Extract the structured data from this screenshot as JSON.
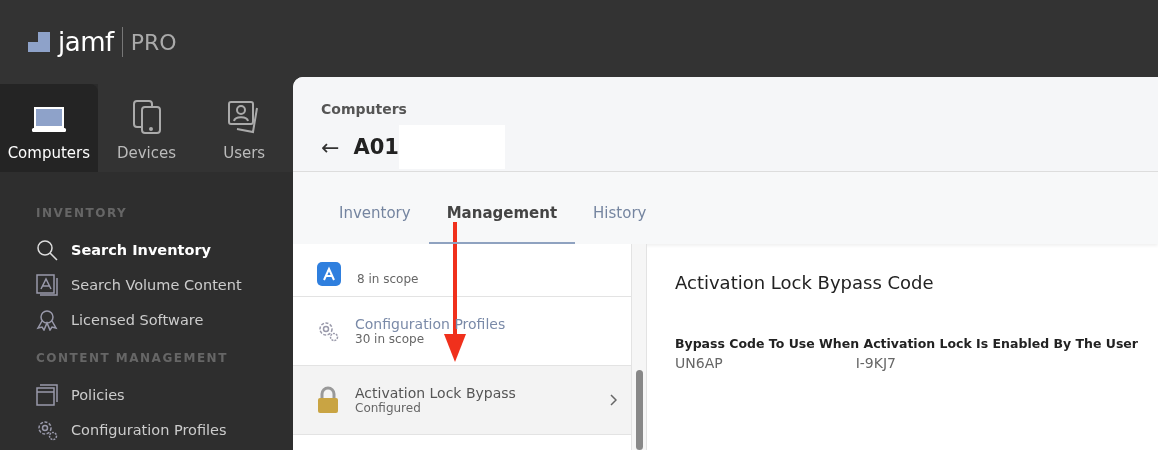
{
  "logo": {
    "brand": "jamf",
    "product": "PRO"
  },
  "nav_tabs": [
    {
      "label": "Computers",
      "kind": "laptop",
      "selected": true
    },
    {
      "label": "Devices",
      "kind": "phone",
      "selected": false
    },
    {
      "label": "Users",
      "kind": "user",
      "selected": false
    }
  ],
  "sidebar": {
    "sections": [
      {
        "heading": "INVENTORY",
        "items": [
          {
            "label": "Search Inventory",
            "kind": "search",
            "selected": true
          },
          {
            "label": "Search Volume Content",
            "kind": "volume",
            "selected": false
          },
          {
            "label": "Licensed Software",
            "kind": "award",
            "selected": false
          }
        ]
      },
      {
        "heading": "CONTENT MANAGEMENT",
        "items": [
          {
            "label": "Policies",
            "kind": "window",
            "selected": false
          },
          {
            "label": "Configuration Profiles",
            "kind": "gear",
            "selected": false
          }
        ]
      }
    ]
  },
  "breadcrumb": "Computers",
  "back_icon": "←",
  "record_title": "A01",
  "tabs": [
    {
      "label": "Inventory",
      "selected": false
    },
    {
      "label": "Management",
      "selected": true
    },
    {
      "label": "History",
      "selected": false
    }
  ],
  "management_list": [
    {
      "subtitle": "8 in scope",
      "kind": "appstore",
      "selected": false
    },
    {
      "title": "Configuration Profiles",
      "subtitle": "30 in scope",
      "kind": "gear",
      "selected": false
    },
    {
      "title": "Activation Lock Bypass",
      "subtitle": "Configured",
      "kind": "lock",
      "selected": true
    }
  ],
  "detail": {
    "title": "Activation Lock Bypass Code",
    "field_label": "Bypass Code To Use When Activation Lock Is Enabled By The User",
    "value_start": "UN6AP",
    "value_end": "I-9KJ7"
  }
}
